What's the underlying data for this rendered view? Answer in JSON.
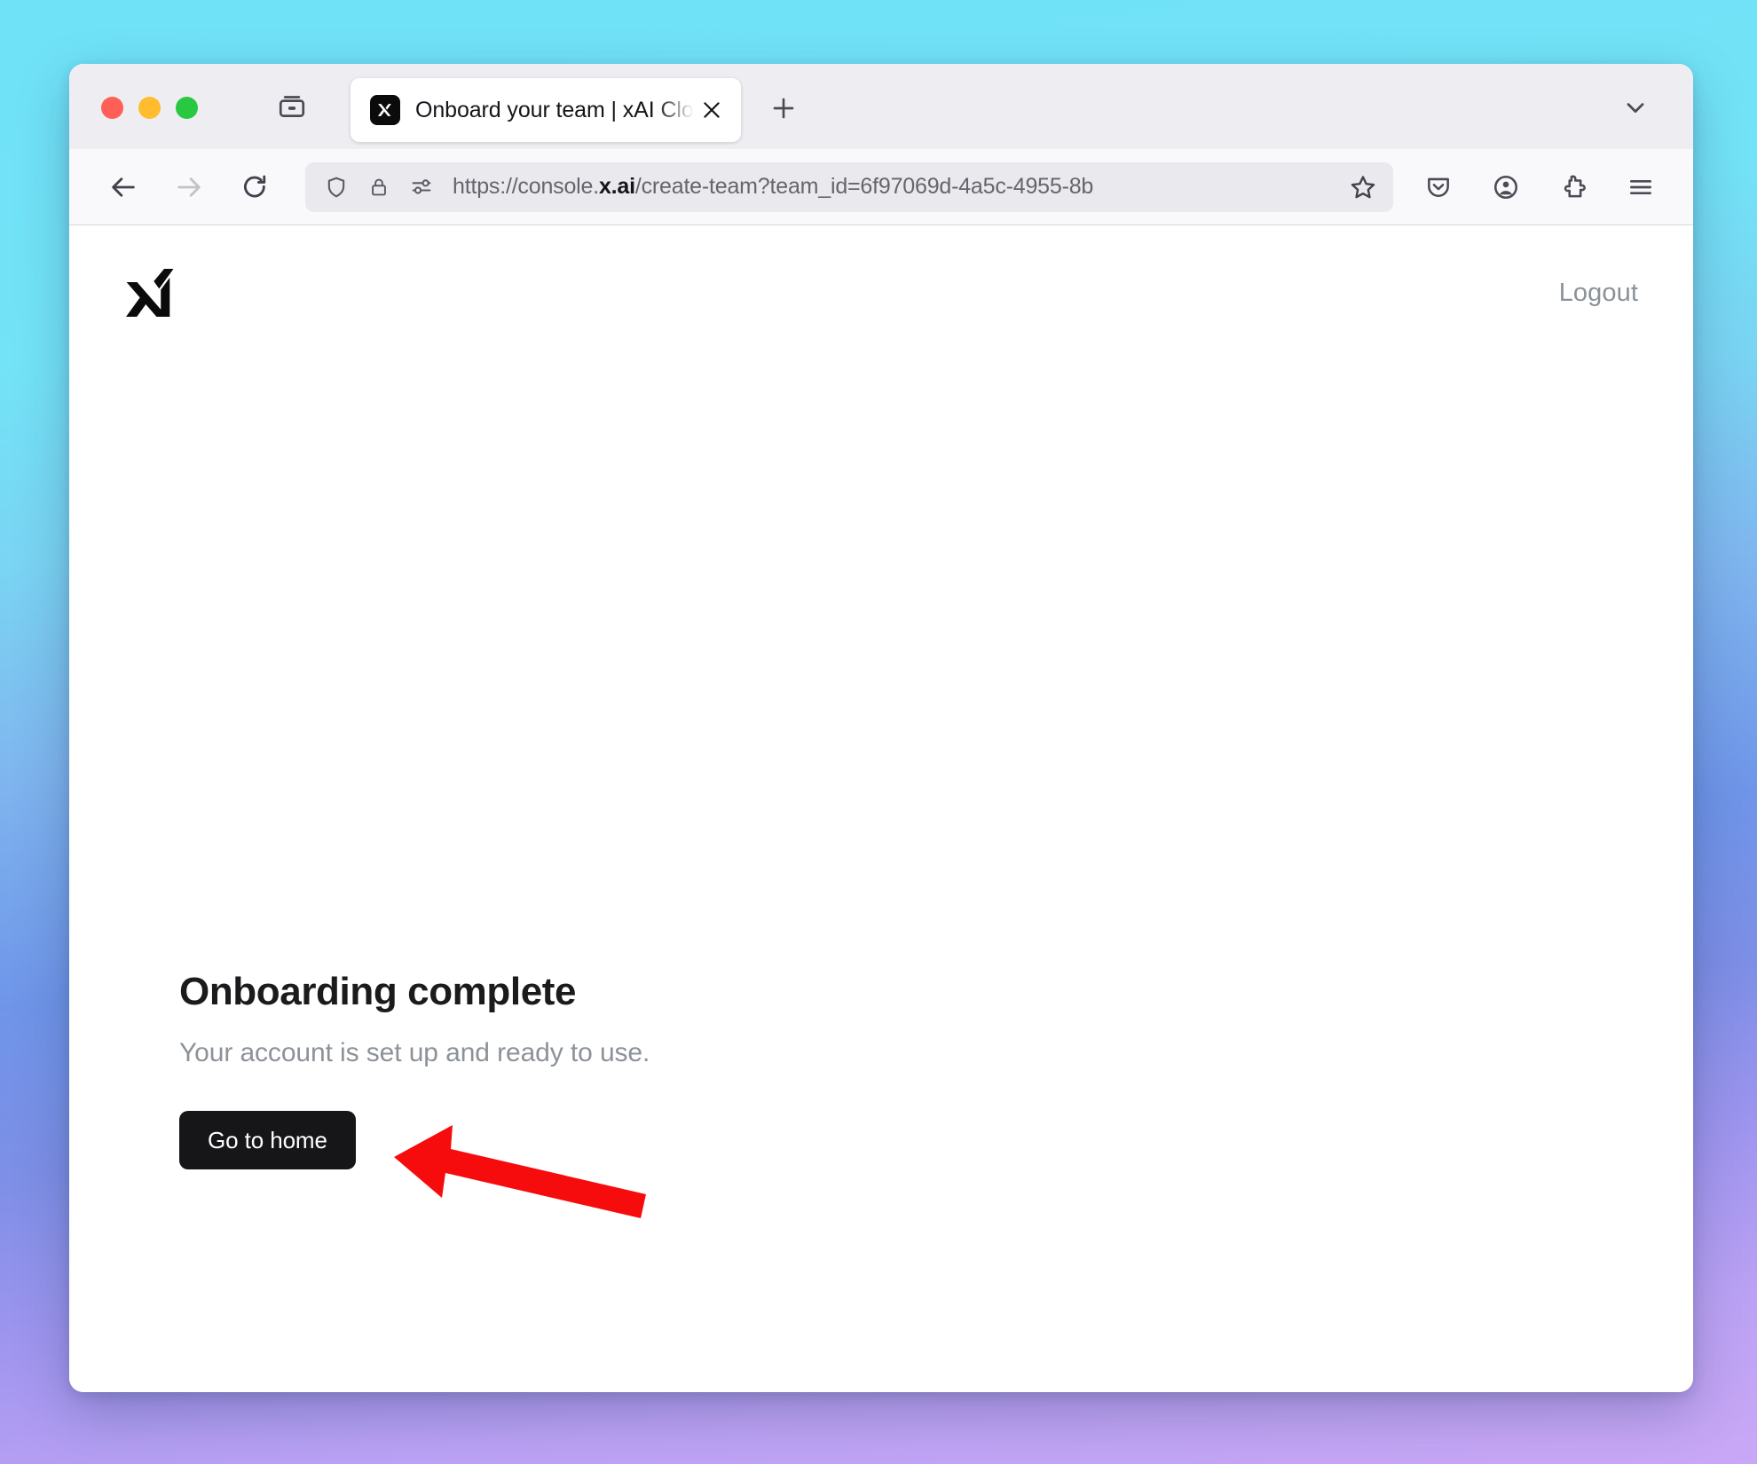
{
  "window": {
    "traffic_lights": [
      "close",
      "minimize",
      "maximize"
    ]
  },
  "browser": {
    "tab": {
      "title": "Onboard your team | xAI Cloud C",
      "favicon": "xai-logo-icon",
      "close_icon": "close-icon"
    },
    "tab_strip": {
      "list_tabs_icon": "tab-group-icon",
      "new_tab_icon": "plus-icon",
      "all_tabs_chevron_icon": "chevron-down-icon"
    },
    "toolbar": {
      "back_icon": "arrow-left-icon",
      "forward_icon": "arrow-right-icon",
      "reload_icon": "reload-icon",
      "shield_icon": "shield-icon",
      "lock_icon": "lock-icon",
      "permissions_icon": "permissions-icon",
      "bookmark_icon": "star-icon",
      "pocket_icon": "pocket-save-icon",
      "account_icon": "account-circle-icon",
      "extensions_icon": "puzzle-piece-icon",
      "menu_icon": "hamburger-menu-icon"
    },
    "url": {
      "full": "https://console.x.ai/create-team?team_id=6f97069d-4a5c-4955-8b",
      "prefix": "https://console.",
      "domain": "x.ai",
      "path": "/create-team?team_id=6f97069d-4a5c-4955-8b"
    }
  },
  "page": {
    "brand": "xai-logo-icon",
    "logout_label": "Logout",
    "title": "Onboarding complete",
    "subtitle": "Your account is set up and ready to use.",
    "primary_button_label": "Go to home",
    "annotation": {
      "type": "arrow",
      "direction": "left",
      "color": "#F60C0C",
      "outline_color": "#FFFFFF",
      "points_at": "Go to home"
    }
  },
  "colors": {
    "accent_button": "#161618",
    "annotation_red": "#F60C0C",
    "title_text": "#1B1B1D",
    "muted_text": "#8D9299",
    "desktop_gradient_top": "#6FE2F8",
    "desktop_gradient_mid": "#6F95E9",
    "desktop_gradient_bottom": "#C9A8F6"
  }
}
